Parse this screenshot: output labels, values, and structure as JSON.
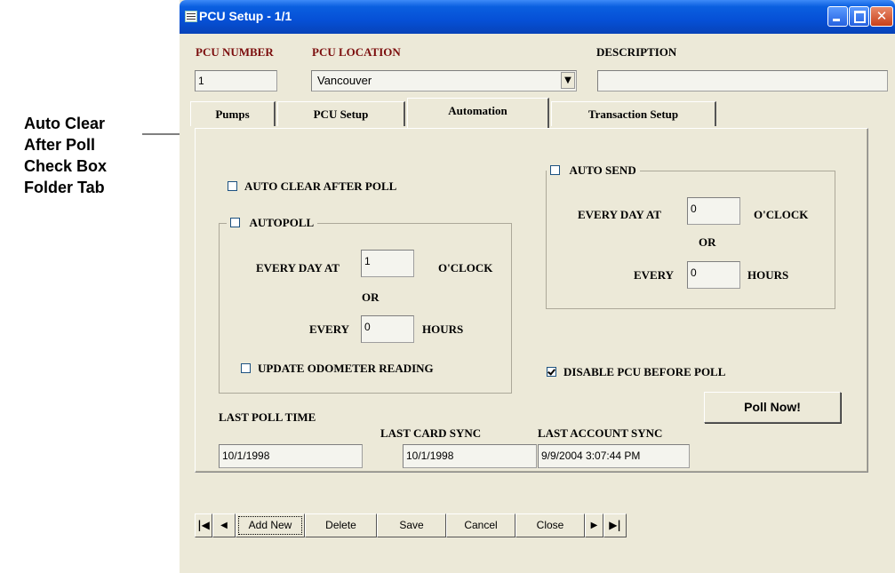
{
  "callout": {
    "lines": [
      "Auto Clear",
      "After Poll",
      "Check Box",
      "Folder Tab"
    ]
  },
  "window": {
    "title": "PCU Setup - 1/1",
    "icons": [
      "app-icon",
      "minimize-icon",
      "maximize-icon",
      "close-icon"
    ]
  },
  "header": {
    "pcu_number_label": "PCU NUMBER",
    "pcu_number_value": "1",
    "pcu_location_label": "PCU LOCATION",
    "pcu_location_value": "Vancouver",
    "description_label": "DESCRIPTION",
    "description_value": ""
  },
  "tabs": [
    {
      "label": "Pumps"
    },
    {
      "label": "PCU Setup"
    },
    {
      "label": "Automation",
      "active": true
    },
    {
      "label": "Transaction Setup"
    }
  ],
  "automation": {
    "auto_clear_label": "AUTO CLEAR AFTER POLL",
    "auto_clear_checked": false,
    "autopoll": {
      "label": "AUTOPOLL",
      "checked": false,
      "every_day_at_label": "EVERY DAY AT",
      "every_day_at_value": "1",
      "oclock_label": "O'CLOCK",
      "or_label": "OR",
      "every_label": "EVERY",
      "every_value": "0",
      "hours_label": "HOURS",
      "update_odometer_label": "UPDATE ODOMETER READING",
      "update_odometer_checked": false
    },
    "autosend": {
      "label": "AUTO SEND",
      "checked": false,
      "every_day_at_label": "EVERY DAY AT",
      "every_day_at_value": "0",
      "oclock_label": "O'CLOCK",
      "or_label": "OR",
      "every_label": "EVERY",
      "every_value": "0",
      "hours_label": "HOURS"
    },
    "disable_pcu_label": "DISABLE PCU BEFORE POLL",
    "disable_pcu_checked": true,
    "poll_now_label": "Poll Now!",
    "last_poll_time_label": "LAST POLL TIME",
    "last_poll_time_value": "10/1/1998",
    "last_card_sync_label": "LAST CARD SYNC",
    "last_card_sync_value": "10/1/1998",
    "last_account_sync_label": "LAST ACCOUNT SYNC",
    "last_account_sync_value": "9/9/2004 3:07:44 PM"
  },
  "navbar": {
    "first_glyph": "|◀",
    "prev_glyph": "◀",
    "add_new_label": "Add New",
    "delete_label": "Delete",
    "save_label": "Save",
    "cancel_label": "Cancel",
    "close_label": "Close",
    "next_glyph": "▶",
    "last_glyph": "▶|"
  }
}
